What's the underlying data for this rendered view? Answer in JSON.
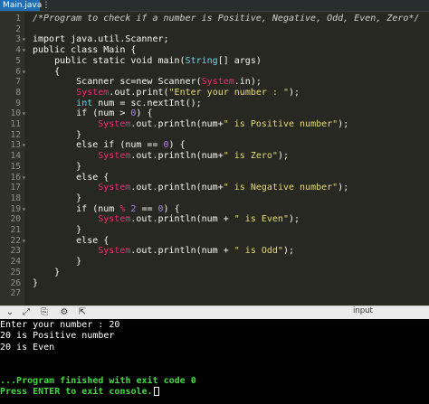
{
  "tab": {
    "filename": "Main.java",
    "menu_icon": "vertical-dots-icon"
  },
  "editor": {
    "lines": [
      {
        "n": "1",
        "fold": "",
        "segs": [
          {
            "t": "/*Program to check if a number is Positive, Negative, Odd, Even, Zero*/",
            "c": "cm"
          }
        ]
      },
      {
        "n": "2",
        "fold": "",
        "segs": []
      },
      {
        "n": "3",
        "fold": "-",
        "segs": [
          {
            "t": "import java.util.Scanner;",
            "c": "kw"
          }
        ]
      },
      {
        "n": "4",
        "fold": "-",
        "segs": [
          {
            "t": "public class Main {",
            "c": "kw"
          }
        ]
      },
      {
        "n": "5",
        "fold": "",
        "segs": [
          {
            "t": "    public static void main(",
            "c": "kw"
          },
          {
            "t": "String",
            "c": "ty"
          },
          {
            "t": "[] args)",
            "c": "kw"
          }
        ]
      },
      {
        "n": "6",
        "fold": "-",
        "segs": [
          {
            "t": "    {",
            "c": "kw"
          }
        ]
      },
      {
        "n": "7",
        "fold": "",
        "segs": [
          {
            "t": "        Scanner sc=new Scanner(",
            "c": "kw"
          },
          {
            "t": "System",
            "c": "sys"
          },
          {
            "t": ".in);",
            "c": "kw"
          }
        ]
      },
      {
        "n": "8",
        "fold": "",
        "segs": [
          {
            "t": "        ",
            "c": "kw"
          },
          {
            "t": "System",
            "c": "sys"
          },
          {
            "t": ".out.print(",
            "c": "kw"
          },
          {
            "t": "\"Enter your number : \"",
            "c": "st"
          },
          {
            "t": ");",
            "c": "kw"
          }
        ]
      },
      {
        "n": "9",
        "fold": "",
        "segs": [
          {
            "t": "        ",
            "c": "kw"
          },
          {
            "t": "int",
            "c": "ty"
          },
          {
            "t": " num = sc.nextInt();",
            "c": "kw"
          }
        ]
      },
      {
        "n": "10",
        "fold": "-",
        "segs": [
          {
            "t": "        if (num > ",
            "c": "kw"
          },
          {
            "t": "0",
            "c": "nm"
          },
          {
            "t": ") {",
            "c": "kw"
          }
        ]
      },
      {
        "n": "11",
        "fold": "",
        "segs": [
          {
            "t": "            ",
            "c": "kw"
          },
          {
            "t": "System",
            "c": "sys"
          },
          {
            "t": ".out.println(num+",
            "c": "kw"
          },
          {
            "t": "\" is Positive number\"",
            "c": "st"
          },
          {
            "t": ");",
            "c": "kw"
          }
        ]
      },
      {
        "n": "12",
        "fold": "",
        "segs": [
          {
            "t": "        }",
            "c": "kw"
          }
        ]
      },
      {
        "n": "13",
        "fold": "-",
        "segs": [
          {
            "t": "        else if (num == ",
            "c": "kw"
          },
          {
            "t": "0",
            "c": "nm"
          },
          {
            "t": ") {",
            "c": "kw"
          }
        ]
      },
      {
        "n": "14",
        "fold": "",
        "segs": [
          {
            "t": "            ",
            "c": "kw"
          },
          {
            "t": "System",
            "c": "sys"
          },
          {
            "t": ".out.println(num+",
            "c": "kw"
          },
          {
            "t": "\" is Zero\"",
            "c": "st"
          },
          {
            "t": ");",
            "c": "kw"
          }
        ]
      },
      {
        "n": "15",
        "fold": "",
        "segs": [
          {
            "t": "        }",
            "c": "kw"
          }
        ]
      },
      {
        "n": "16",
        "fold": "-",
        "segs": [
          {
            "t": "        else {",
            "c": "kw"
          }
        ]
      },
      {
        "n": "17",
        "fold": "",
        "segs": [
          {
            "t": "            ",
            "c": "kw"
          },
          {
            "t": "System",
            "c": "sys"
          },
          {
            "t": ".out.println(num+",
            "c": "kw"
          },
          {
            "t": "\" is Negative number\"",
            "c": "st"
          },
          {
            "t": ");",
            "c": "kw"
          }
        ]
      },
      {
        "n": "18",
        "fold": "",
        "segs": [
          {
            "t": "        }",
            "c": "kw"
          }
        ]
      },
      {
        "n": "19",
        "fold": "-",
        "segs": [
          {
            "t": "        if (num ",
            "c": "kw"
          },
          {
            "t": "%",
            "c": "op"
          },
          {
            "t": " ",
            "c": "kw"
          },
          {
            "t": "2",
            "c": "nm"
          },
          {
            "t": " == ",
            "c": "kw"
          },
          {
            "t": "0",
            "c": "nm"
          },
          {
            "t": ") {",
            "c": "kw"
          }
        ]
      },
      {
        "n": "20",
        "fold": "",
        "segs": [
          {
            "t": "            ",
            "c": "kw"
          },
          {
            "t": "System",
            "c": "sys"
          },
          {
            "t": ".out.println(num + ",
            "c": "kw"
          },
          {
            "t": "\" is Even\"",
            "c": "st"
          },
          {
            "t": ");",
            "c": "kw"
          }
        ]
      },
      {
        "n": "21",
        "fold": "",
        "segs": [
          {
            "t": "        }",
            "c": "kw"
          }
        ]
      },
      {
        "n": "22",
        "fold": "-",
        "segs": [
          {
            "t": "        else {",
            "c": "kw"
          }
        ]
      },
      {
        "n": "23",
        "fold": "",
        "segs": [
          {
            "t": "            ",
            "c": "kw"
          },
          {
            "t": "System",
            "c": "sys"
          },
          {
            "t": ".out.println(num + ",
            "c": "kw"
          },
          {
            "t": "\" is Odd\"",
            "c": "st"
          },
          {
            "t": ");",
            "c": "kw"
          }
        ]
      },
      {
        "n": "24",
        "fold": "",
        "segs": [
          {
            "t": "        }",
            "c": "kw"
          }
        ]
      },
      {
        "n": "25",
        "fold": "",
        "segs": [
          {
            "t": "    }",
            "c": "kw"
          }
        ]
      },
      {
        "n": "26",
        "fold": "",
        "segs": [
          {
            "t": "}",
            "c": "kw"
          }
        ]
      },
      {
        "n": "27",
        "fold": "",
        "segs": []
      }
    ]
  },
  "toolbar": {
    "icons": [
      "chevron-down-icon",
      "expand-icon",
      "copy-icon",
      "settings-icon",
      "share-icon"
    ],
    "input_label": "input"
  },
  "console": {
    "lines": [
      {
        "text": "Enter your number : 20",
        "style": "normal"
      },
      {
        "text": "20 is Positive number",
        "style": "normal"
      },
      {
        "text": "20 is Even",
        "style": "normal"
      },
      {
        "text": "",
        "style": "normal"
      },
      {
        "text": "",
        "style": "normal"
      },
      {
        "text": "...Program finished with exit code 0",
        "style": "green"
      },
      {
        "text": "Press ENTER to exit console.",
        "style": "green",
        "cursor": true
      }
    ]
  }
}
